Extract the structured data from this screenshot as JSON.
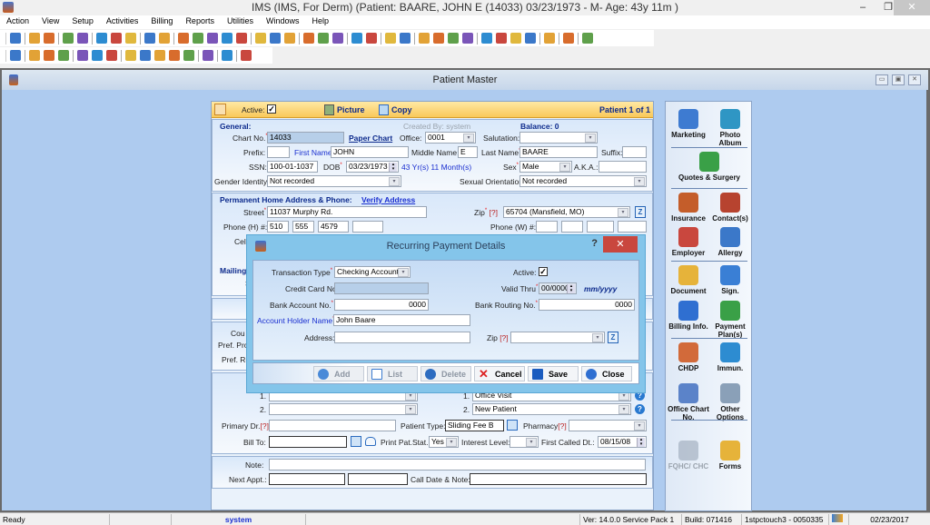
{
  "window": {
    "title": "IMS (IMS, For Derm)    (Patient: BAARE, JOHN E (14033) 03/23/1973 - M- Age: 43y 11m )",
    "minimize": "‒",
    "restore": "❐",
    "close": "✕"
  },
  "menu": [
    "Action",
    "View",
    "Setup",
    "Activities",
    "Billing",
    "Reports",
    "Utilities",
    "Windows",
    "Help"
  ],
  "toolbar1_icons": [
    "patient-icon",
    "doctor-icon",
    "doctor-check-icon",
    "folder-icon",
    "edit-icon",
    "rx-icon",
    "lab-flask-icon",
    "shield-icon",
    "claim-icon",
    "note-icon",
    "dollar-icon",
    "dollar-plus-icon",
    "payment-icon",
    "dollar-user-icon",
    "dollar-transfer-icon",
    "calendar-icon",
    "users-icon",
    "letter-icon",
    "fax-icon",
    "chart-icon",
    "chart-check-icon",
    "report-icon",
    "bar-chart-icon",
    "document-user-icon",
    "form-icon",
    "import-icon",
    "transfer-icon",
    "word-icon",
    "checklist-icon",
    "grid-add-icon",
    "camera-icon",
    "toggle-icon",
    "document-icon",
    "help-icon",
    "lock-icon",
    "exit-icon"
  ],
  "toolbar2_icons": [
    "binoculars-icon",
    "add-record-icon",
    "edit-record-icon",
    "delete-record-icon",
    "save-icon",
    "open-icon",
    "copy-icon",
    "first-record-icon",
    "prev-record-icon",
    "next-record-icon",
    "last-record-icon",
    "sort-icon",
    "refresh-icon",
    "help-icon",
    "close-icon"
  ],
  "patient_master": {
    "title": "Patient Master",
    "header": {
      "active_label": "Active:",
      "active_checked": true,
      "picture": "Picture",
      "copy": "Copy",
      "record_position": "Patient 1 of 1"
    },
    "general": {
      "section_label": "General:",
      "created_by": "Created By: system",
      "balance": "Balance: 0",
      "chart_no_label": "Chart No.",
      "chart_no": "14033",
      "paper_chart": "Paper Chart",
      "office_label": "Office:",
      "office": "0001",
      "salutation_label": "Salutation:",
      "salutation": "",
      "prefix_label": "Prefix:",
      "prefix": "",
      "first_name_label": "First Name",
      "first_name": "JOHN",
      "middle_name_label": "Middle Name:",
      "middle_name": "E",
      "last_name_label": "Last Name",
      "last_name": "BAARE",
      "suffix_label": "Suffix:",
      "suffix": "",
      "ssn_label": "SSN:",
      "ssn": "100-01-1037",
      "dob_label": "DOB",
      "dob": "03/23/1973",
      "age": "43 Yr(s) 11 Month(s)",
      "sex_label": "Sex",
      "sex": "Male",
      "aka_label": "A.K.A.:",
      "aka": "",
      "gender_identity_label": "Gender Identity:",
      "gender_identity": "Not recorded",
      "sexual_orientation_label": "Sexual Orientation:",
      "sexual_orientation": "Not recorded"
    },
    "address": {
      "section_label": "Permanent Home Address & Phone:",
      "verify": "Verify Address",
      "street_label": "Street",
      "street": "11037 Murphy Rd.",
      "zip_label": "Zip",
      "zip_help": "[?]",
      "zip": "65704      (Mansfield, MO)",
      "phone_h_label": "Phone (H) #:",
      "phone_h": [
        "510",
        "555",
        "4579",
        ""
      ],
      "phone_w_label": "Phone (W) #:",
      "phone_w": [
        "",
        "",
        "",
        ""
      ],
      "cell_label": "Cell",
      "mailing_label": "Mailing",
      "mailing_street_label": "S"
    },
    "misc": {
      "country_label": "Cou",
      "pref_pro_label": "Pref. Pro",
      "pref_re_label": "Pref. Re",
      "ref1_label": "1.",
      "ref2_label": "2.",
      "ref1": "",
      "ref2": "",
      "type1_label": "1.",
      "type1": "Office Visit",
      "type2_label": "2.",
      "type2": "New Patient",
      "primary_dr_label": "Primary Dr.",
      "primary_dr_help": "[?]",
      "primary_dr": "",
      "patient_type_label": "Patient Type:",
      "patient_type": "Sliding Fee B",
      "pharmacy_label": "Pharmacy",
      "pharmacy_help": "[?]",
      "pharmacy": "",
      "bill_to_label": "Bill To:",
      "bill_to": "",
      "print_pat_stat_label": "Print Pat.Stat.:",
      "print_pat_stat": "Yes",
      "interest_level_label": "Interest Level:",
      "interest_level": "",
      "first_called_label": "First Called Dt.:",
      "first_called": "08/15/08"
    },
    "notes": {
      "note_label": "Note:",
      "note": "",
      "next_appt_label": "Next Appt.:",
      "next_appt_1": "",
      "next_appt_2": "",
      "call_date_label": "Call Date & Note:",
      "call_date": ""
    },
    "right_panel": [
      {
        "label": "Marketing",
        "icon": "marketing-icon"
      },
      {
        "label": "Photo Album",
        "icon": "photo-album-icon"
      },
      {
        "label": "Quotes & Surgery",
        "icon": "quotes-surgery-icon"
      },
      {
        "label": "Insurance",
        "icon": "insurance-icon"
      },
      {
        "label": "Contact(s)",
        "icon": "contacts-icon"
      },
      {
        "label": "Employer",
        "icon": "employer-icon"
      },
      {
        "label": "Allergy",
        "icon": "allergy-icon"
      },
      {
        "label": "Document",
        "icon": "document-icon"
      },
      {
        "label": "Sign.",
        "icon": "signature-icon"
      },
      {
        "label": "Billing Info.",
        "icon": "billing-info-icon"
      },
      {
        "label": "Payment Plan(s)",
        "icon": "payment-plan-icon"
      },
      {
        "label": "CHDP",
        "icon": "chdp-icon"
      },
      {
        "label": "Immun.",
        "icon": "immunization-icon"
      },
      {
        "label": "Office Chart No.",
        "icon": "office-chart-icon"
      },
      {
        "label": "Other Options",
        "icon": "gear-icon"
      },
      {
        "label": "FQHC/ CHC",
        "icon": "fqhc-icon",
        "disabled": true
      },
      {
        "label": "Forms",
        "icon": "forms-icon"
      }
    ]
  },
  "dialog": {
    "title": "Recurring Payment Details",
    "help": "?",
    "close": "✕",
    "transaction_type_label": "Transaction Type",
    "transaction_type": "Checking Account",
    "active_label": "Active:",
    "active_checked": true,
    "credit_card_label": "Credit Card No.",
    "credit_card": "",
    "valid_thru_label": "Valid Thru",
    "valid_thru": "00/0000",
    "valid_thru_format": "mm/yyyy",
    "bank_account_label": "Bank Account No.",
    "bank_account": "0000",
    "bank_routing_label": "Bank Routing No.",
    "bank_routing": "0000",
    "holder_name_label": "Account Holder Name",
    "holder_name": "John Baare",
    "address_label": "Address:",
    "address": "",
    "zip_label": "Zip",
    "zip_help": "[?]",
    "zip": "",
    "buttons": {
      "add": "Add",
      "list": "List",
      "delete": "Delete",
      "cancel": "Cancel",
      "save": "Save",
      "close": "Close"
    }
  },
  "status": {
    "state": "Ready",
    "user": "system",
    "version": "Ver: 14.0.0 Service Pack 1",
    "build": "Build: 071416",
    "station": "1stpctouch3 - 0050335",
    "date": "02/23/2017"
  }
}
